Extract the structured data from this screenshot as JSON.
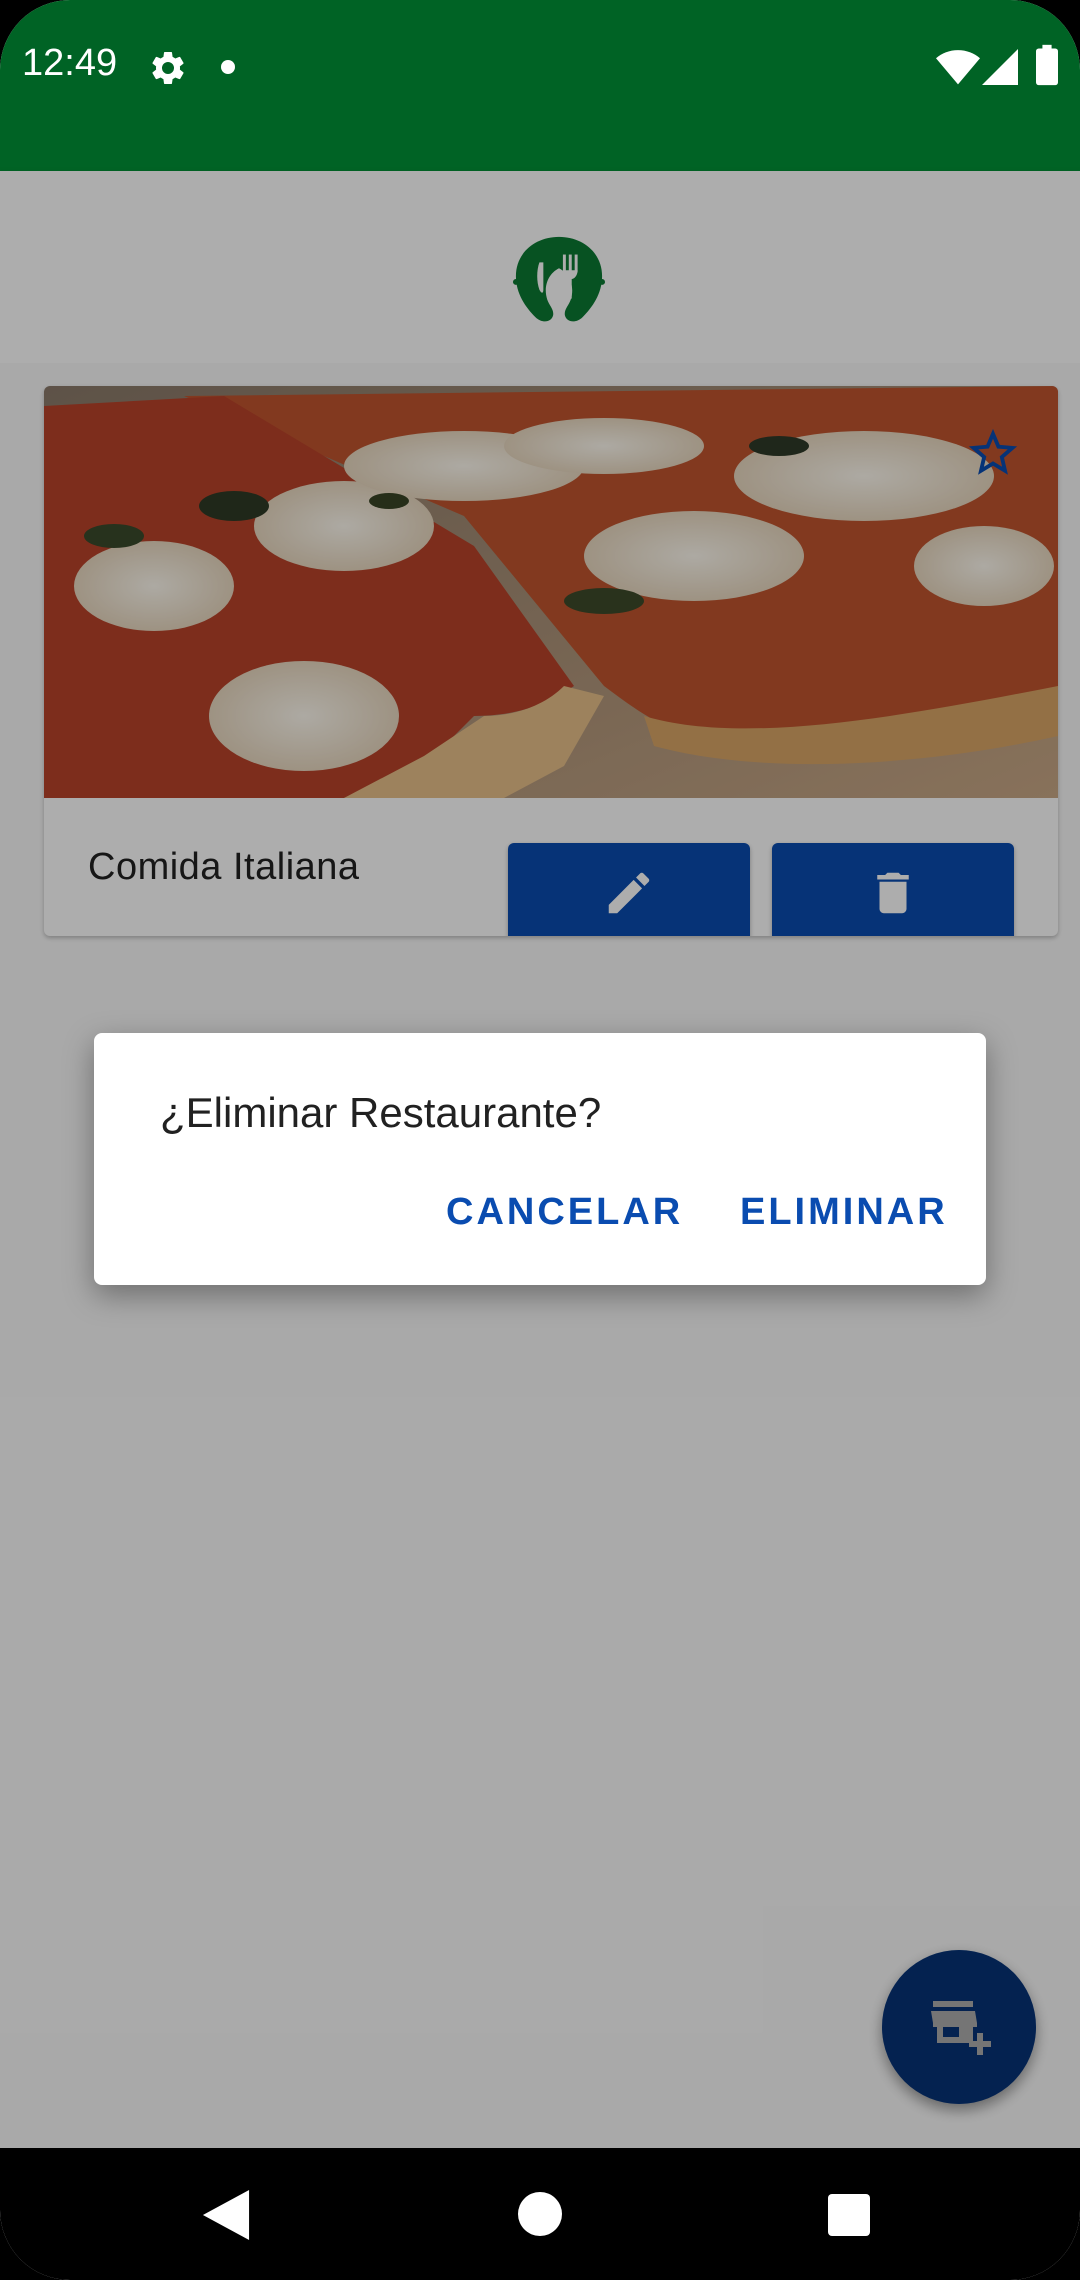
{
  "status_bar": {
    "time": "12:49",
    "icons": [
      "gear-icon",
      "dot-icon",
      "wifi-icon",
      "signal-icon",
      "battery-icon"
    ],
    "color": "#006325"
  },
  "app_bar": {
    "logo_icon": "restaurant-logo-icon"
  },
  "restaurant_card": {
    "title": "Comida Italiana",
    "image_icon": "pizza-photo",
    "favorite_icon": "star-outline-icon",
    "edit_icon": "pencil-icon",
    "delete_icon": "trash-icon"
  },
  "dialog": {
    "title": "¿Eliminar Restaurante?",
    "cancel_label": "CANCELAR",
    "confirm_label": "ELIMINAR"
  },
  "fab": {
    "icon": "add-store-icon"
  },
  "nav_bar": {
    "icons": [
      "back-icon",
      "home-icon",
      "recents-icon"
    ]
  },
  "colors": {
    "primary": "#0a4cb0",
    "status_bar": "#006325",
    "logo_green": "#0b7a33"
  }
}
